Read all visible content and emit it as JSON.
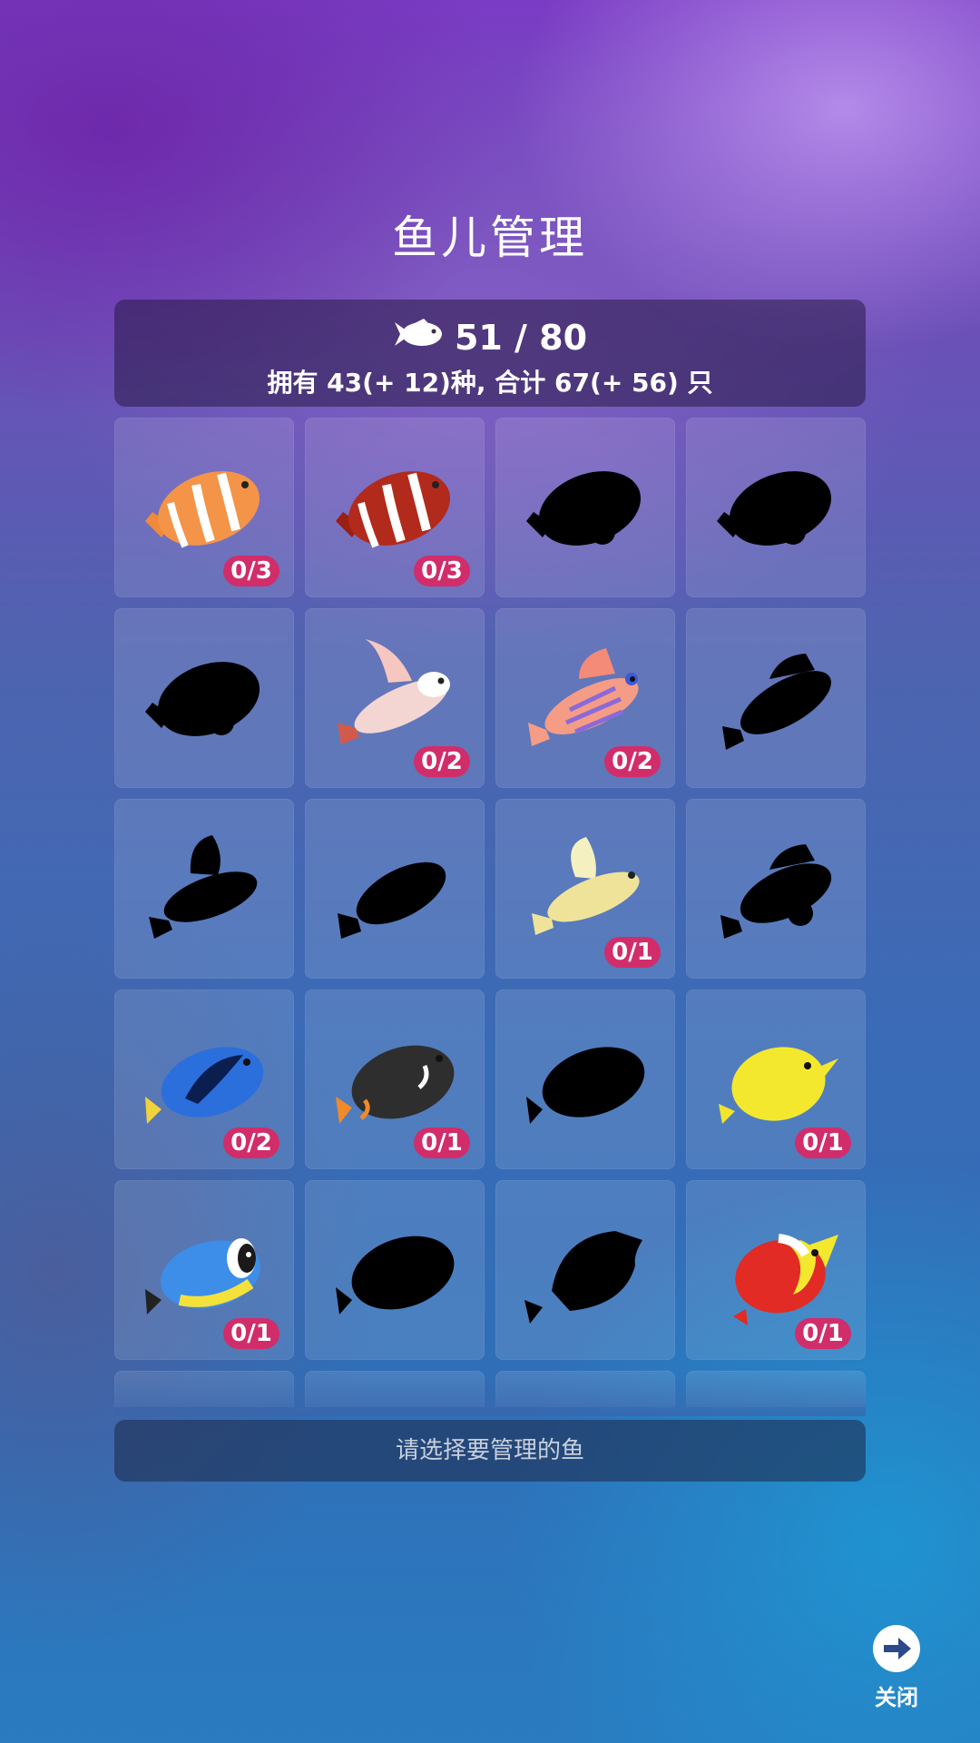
{
  "header": {
    "title": "鱼儿管理"
  },
  "stats": {
    "capacity": "51 / 80",
    "summary": "拥有 43(+ 12)种, 合计 67(+ 56) 只"
  },
  "grid": {
    "cells": [
      {
        "fish": "clownfish-orange",
        "count": "0/3"
      },
      {
        "fish": "clownfish-red",
        "count": "0/3"
      },
      {
        "fish": "locked",
        "count": ""
      },
      {
        "fish": "locked",
        "count": ""
      },
      {
        "fish": "locked",
        "count": ""
      },
      {
        "fish": "pink-goby",
        "count": "0/2"
      },
      {
        "fish": "striped-goby",
        "count": "0/2"
      },
      {
        "fish": "locked",
        "count": ""
      },
      {
        "fish": "locked",
        "count": ""
      },
      {
        "fish": "locked",
        "count": ""
      },
      {
        "fish": "yellow-goby",
        "count": "0/1"
      },
      {
        "fish": "locked",
        "count": ""
      },
      {
        "fish": "blue-tang",
        "count": "0/2"
      },
      {
        "fish": "black-surgeonfish",
        "count": "0/1"
      },
      {
        "fish": "locked",
        "count": ""
      },
      {
        "fish": "yellow-tang",
        "count": "0/1"
      },
      {
        "fish": "powder-blue-tang",
        "count": "0/1"
      },
      {
        "fish": "locked",
        "count": ""
      },
      {
        "fish": "locked",
        "count": ""
      },
      {
        "fish": "red-yellow-butterflyfish",
        "count": "0/1"
      }
    ]
  },
  "footer": {
    "hint": "请选择要管理的鱼"
  },
  "close": {
    "label": "关闭"
  },
  "colors": {
    "badge": "#d12d6a",
    "accent_panel": "#2e1f4f"
  }
}
